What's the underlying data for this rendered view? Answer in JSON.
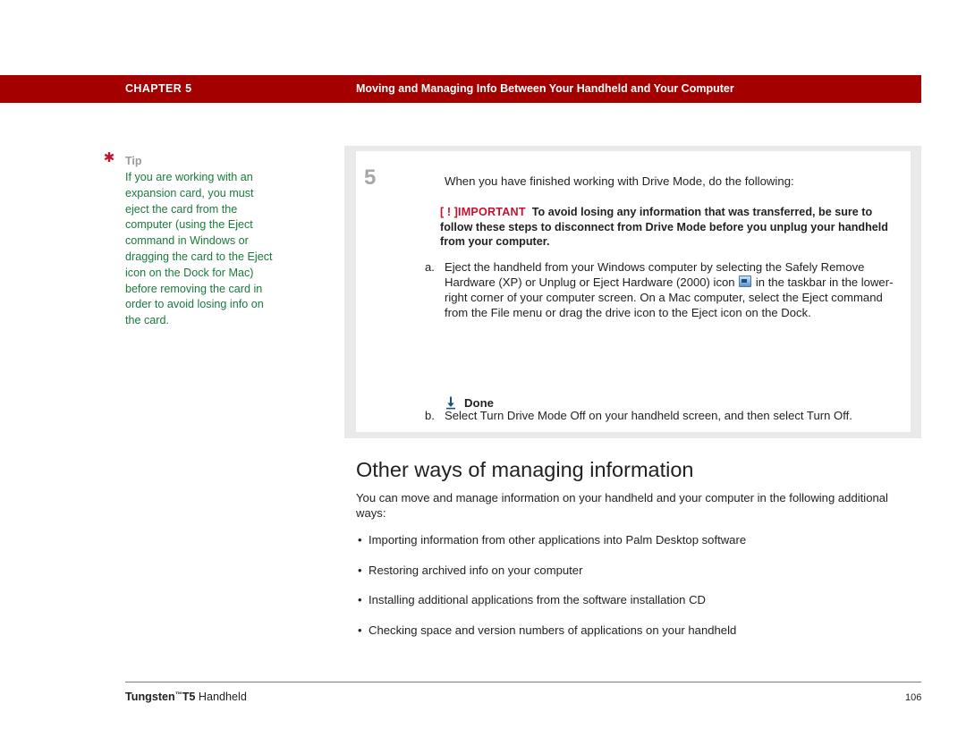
{
  "header": {
    "chapter": "CHAPTER 5",
    "title": "Moving and Managing Info Between Your Handheld and Your Computer"
  },
  "tip": {
    "icon": "asterisk-icon",
    "label": "Tip",
    "body": "If you are working with an expansion card, you must eject the card from the computer (using the Eject command in Windows or dragging the card to the Eject icon on the Dock for Mac) before removing the card in order to avoid losing info on the card."
  },
  "step": {
    "number": "5",
    "intro": "When you have finished working with Drive Mode, do the following:",
    "important_tag": "IMPORTANT",
    "important_text": "To avoid losing any information that was transferred, be sure to follow these steps to disconnect from Drive Mode before you unplug your handheld from your computer.",
    "items": [
      {
        "letter": "a.",
        "text_part1": "Eject the handheld from your Windows computer by selecting the Safely Remove Hardware (XP) or Unplug or Eject Hardware (2000) icon",
        "text_part2": "in the taskbar in the lower-right corner of your computer screen. On a Mac computer, select the Eject command from the File menu or drag the drive icon to the Eject icon on the Dock."
      },
      {
        "letter": "b.",
        "text_part1": "Select Turn Drive Mode Off on your handheld screen, and then select Turn Off.",
        "text_part2": ""
      }
    ],
    "done_label": "Done",
    "done_icon": "down-arrow-icon"
  },
  "section": {
    "title": "Other ways of managing information",
    "intro": "You can move and manage information on your handheld and your computer in the following additional ways:",
    "bullets": [
      "Importing information from other applications into Palm Desktop software",
      "Restoring archived info on your computer",
      "Installing additional applications from the software installation CD",
      "Checking space and version numbers of applications on your handheld"
    ]
  },
  "footer": {
    "brand": "Tungsten",
    "tm": "™",
    "model": "T5",
    "product": " Handheld",
    "page": "106"
  },
  "colors": {
    "header_bar": "#a40000",
    "tip_text": "#1a7a3c",
    "important_red": "#c8102e",
    "step_box": "#e9e9e9",
    "step_number": "#a8a8a8"
  }
}
